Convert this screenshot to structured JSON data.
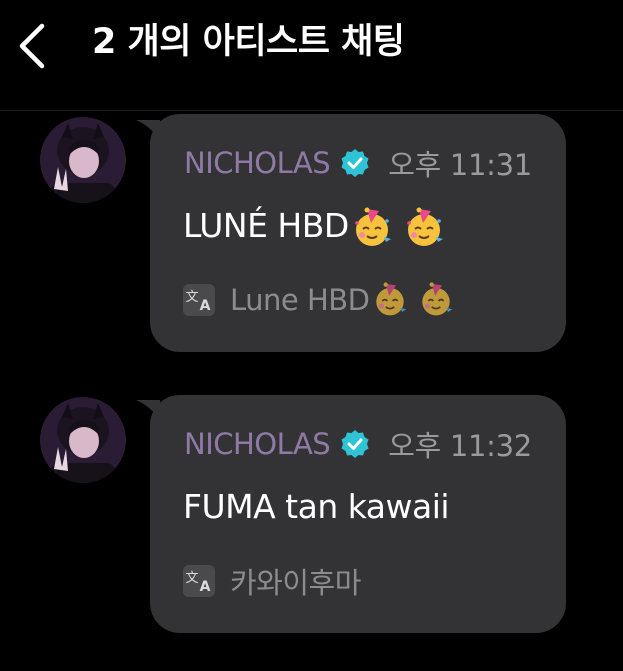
{
  "header": {
    "title": "2 개의 아티스트 채팅",
    "back_icon": "chevron-left-icon"
  },
  "colors": {
    "background": "#000000",
    "bubble": "#333335",
    "name": "#8f7aa6",
    "verified": "#2ec4d6",
    "timestamp": "#9a9a9a",
    "translation_text": "#8c8c8c"
  },
  "messages": [
    {
      "sender": "NICHOLAS",
      "verified": true,
      "time": "오후 11:31",
      "text": "LUNÉ HBD",
      "emojis": [
        "partying-face-emoji",
        "partying-face-emoji"
      ],
      "translation": {
        "icon": "translate-icon",
        "text": "Lune HBD",
        "emojis": [
          "partying-face-emoji",
          "partying-face-emoji"
        ]
      }
    },
    {
      "sender": "NICHOLAS",
      "verified": true,
      "time": "오후 11:32",
      "text": "FUMA tan kawaii",
      "emojis": [],
      "translation": {
        "icon": "translate-icon",
        "text": "카와이후마",
        "emojis": []
      }
    }
  ]
}
